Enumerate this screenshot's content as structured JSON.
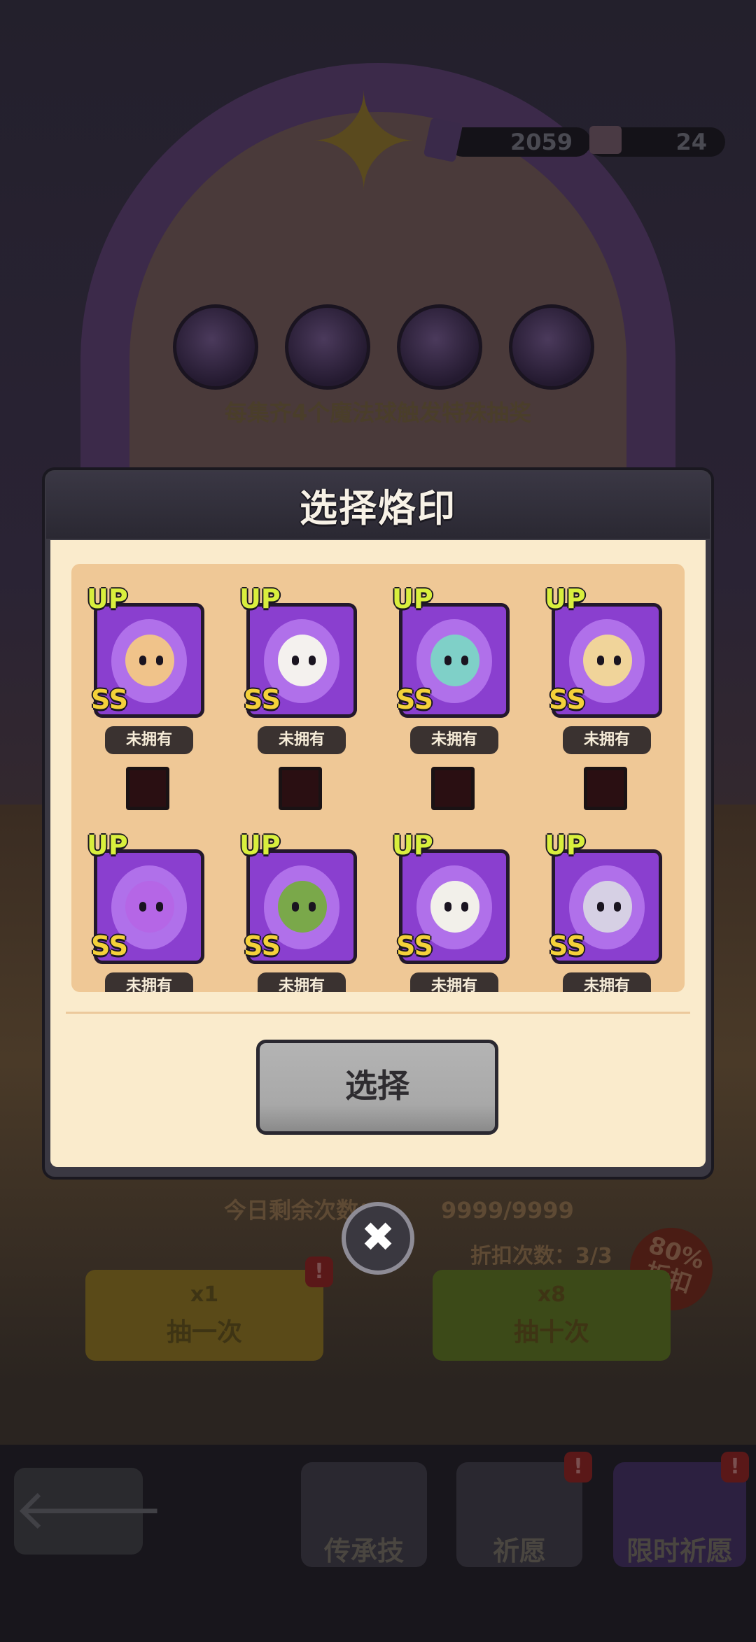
{
  "resources": {
    "gems": "2059",
    "tickets": "24"
  },
  "background": {
    "hint": "每集齐4个魔法球触发特殊抽奖",
    "daily_remaining_label": "今日剩余次数：",
    "daily_remaining_value": "9999/9999",
    "discount_label": "折扣次数：",
    "discount_value": "3/3",
    "discount_badge": "80%",
    "discount_badge_sub": "折扣",
    "draw_one": {
      "label": "抽一次",
      "cost": "x1"
    },
    "draw_ten": {
      "label": "抽十次",
      "cost": "x8"
    },
    "nav": [
      {
        "label": "传承技"
      },
      {
        "label": "祈愿"
      },
      {
        "label": "限时祈愿"
      }
    ],
    "badge_mark": "!"
  },
  "dialog": {
    "title": "选择烙印",
    "select_label": "选择",
    "close_glyph": "✖",
    "cards": [
      {
        "up": "UP",
        "rank": "SS",
        "status": "未拥有",
        "color": "#f0c38a"
      },
      {
        "up": "UP",
        "rank": "SS",
        "status": "未拥有",
        "color": "#f4f1ee"
      },
      {
        "up": "UP",
        "rank": "SS",
        "status": "未拥有",
        "color": "#7fd0c8"
      },
      {
        "up": "UP",
        "rank": "SS",
        "status": "未拥有",
        "color": "#f0d49a"
      },
      {
        "up": "UP",
        "rank": "SS",
        "status": "未拥有",
        "color": "#b566e6"
      },
      {
        "up": "UP",
        "rank": "SS",
        "status": "未拥有",
        "color": "#7aa84a"
      },
      {
        "up": "UP",
        "rank": "SS",
        "status": "未拥有",
        "color": "#f2f0ea"
      },
      {
        "up": "UP",
        "rank": "SS",
        "status": "未拥有",
        "color": "#d6d0e4"
      }
    ]
  }
}
